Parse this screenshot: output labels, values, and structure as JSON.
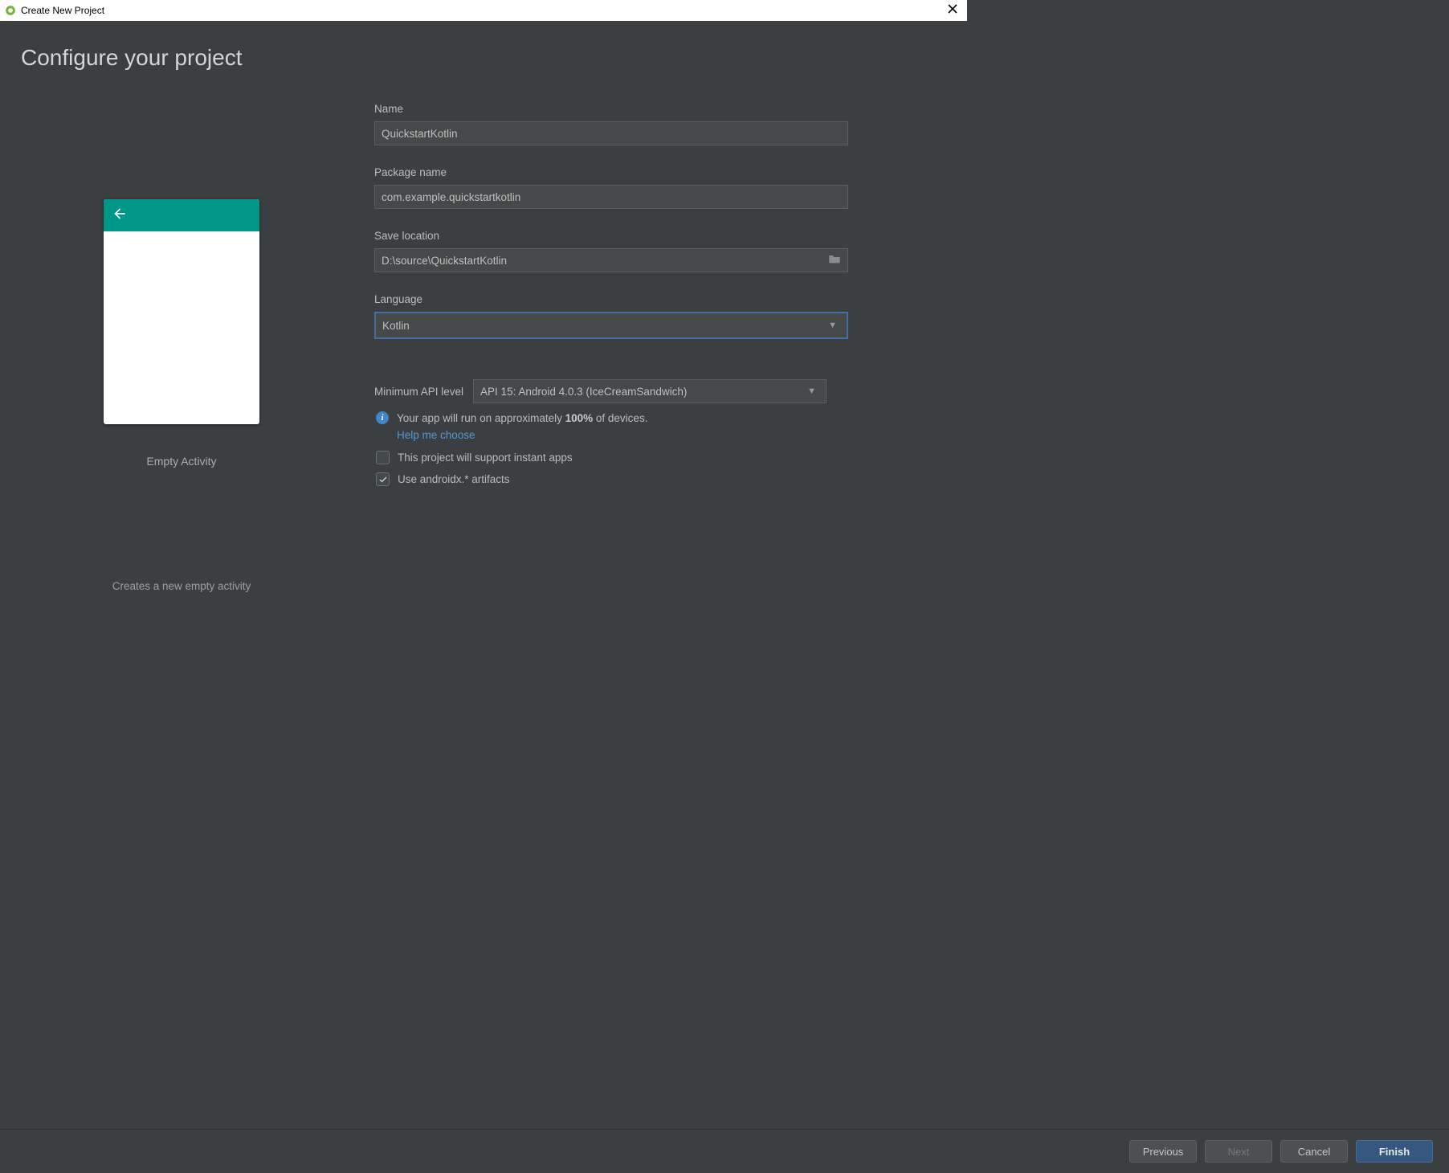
{
  "window": {
    "title": "Create New Project"
  },
  "page": {
    "heading": "Configure your project"
  },
  "preview": {
    "template_name": "Empty Activity",
    "description": "Creates a new empty activity"
  },
  "form": {
    "name": {
      "label": "Name",
      "value": "QuickstartKotlin"
    },
    "package": {
      "label": "Package name",
      "value": "com.example.quickstartkotlin"
    },
    "location": {
      "label": "Save location",
      "value": "D:\\source\\QuickstartKotlin"
    },
    "language": {
      "label": "Language",
      "value": "Kotlin"
    },
    "api": {
      "label": "Minimum API level",
      "value": "API 15: Android 4.0.3 (IceCreamSandwich)",
      "info_prefix": "Your app will run on approximately ",
      "info_percent": "100%",
      "info_suffix": " of devices.",
      "help_link": "Help me choose"
    },
    "instant_apps": {
      "label": "This project will support instant apps",
      "checked": false
    },
    "androidx": {
      "label": "Use androidx.* artifacts",
      "checked": true
    }
  },
  "buttons": {
    "previous": "Previous",
    "next": "Next",
    "cancel": "Cancel",
    "finish": "Finish"
  }
}
